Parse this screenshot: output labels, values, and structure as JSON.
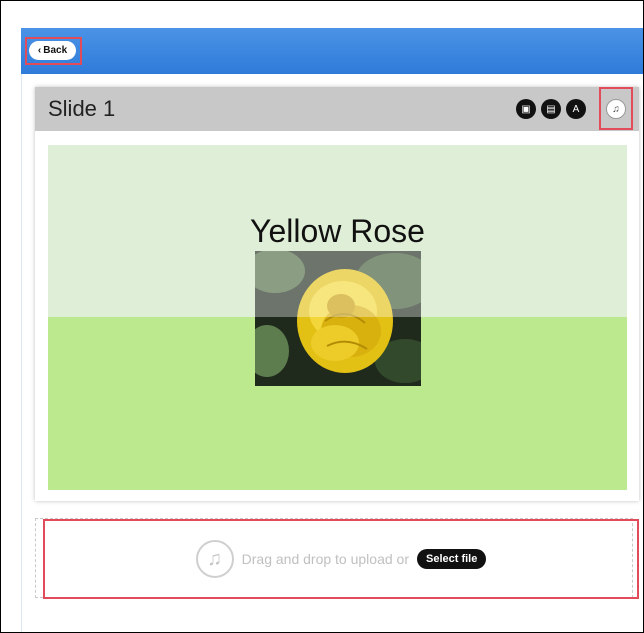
{
  "header": {
    "back_label": "Back",
    "back_icon": "chevron-left-icon"
  },
  "slide": {
    "title": "Slide 1",
    "tools": [
      {
        "name": "image-icon",
        "glyph": "▣"
      },
      {
        "name": "video-icon",
        "glyph": "▤"
      },
      {
        "name": "text-icon",
        "glyph": "A"
      },
      {
        "name": "music-icon",
        "glyph": "♫"
      }
    ],
    "heading": "Yellow Rose"
  },
  "upload": {
    "icon": "music-note-icon",
    "glyph": "♫",
    "text": "Drag and drop to upload or",
    "button_label": "Select file"
  },
  "colors": {
    "topbar": "#2f7bd9",
    "highlight": "#e24b5a",
    "canvas_top": "#dfeed7",
    "canvas_bottom": "#bde98e"
  }
}
